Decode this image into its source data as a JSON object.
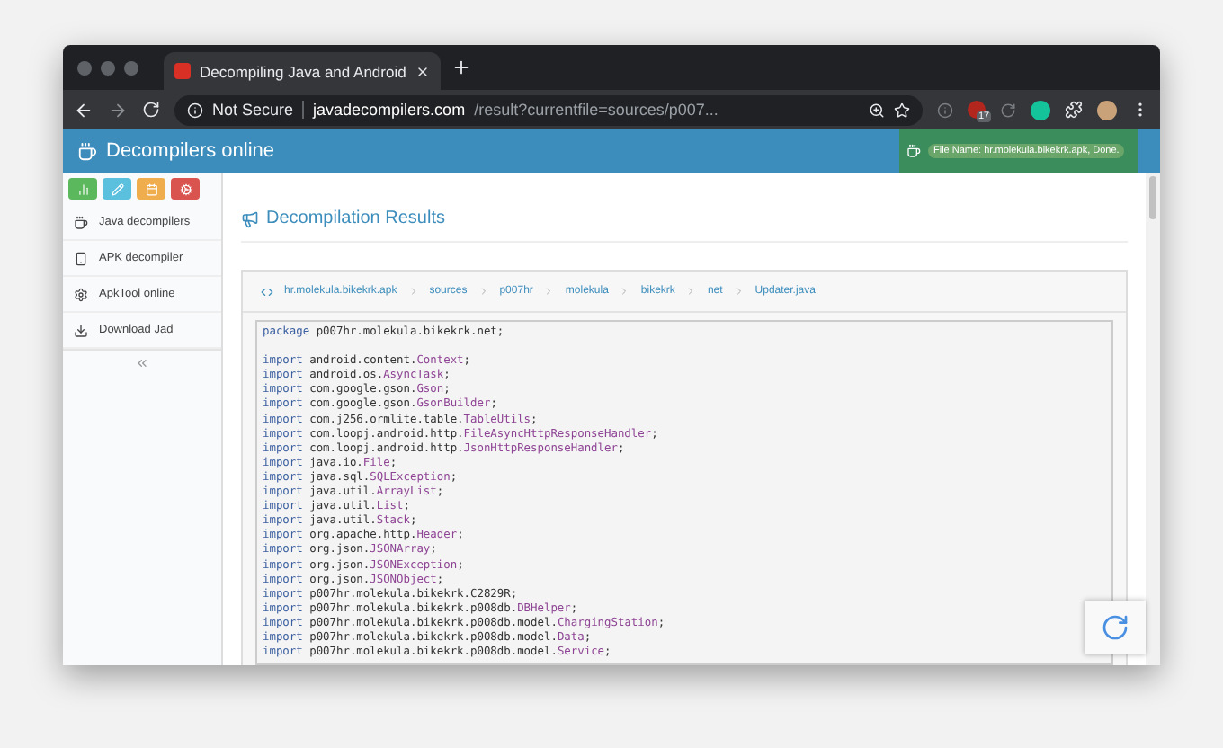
{
  "browser": {
    "tab": {
      "title": "Decompiling Java and Android"
    },
    "address": {
      "security": "Not Secure",
      "domain": "javadecompilers.com",
      "path": "/result?currentfile=sources/p007..."
    },
    "extension_badge": "17"
  },
  "header": {
    "title": "Decompilers online",
    "status": "File Name: hr.molekula.bikekrk.apk, Done."
  },
  "sidebar": {
    "tool_buttons": [
      {
        "kind": "signal",
        "color": "#5cb85c"
      },
      {
        "kind": "pencil",
        "color": "#5bc0de"
      },
      {
        "kind": "calendar",
        "color": "#f0ad4e"
      },
      {
        "kind": "gears",
        "color": "#d9534f"
      }
    ],
    "items": [
      {
        "kind": "cup",
        "label": "Java decompilers"
      },
      {
        "kind": "phone",
        "label": "APK decompiler"
      },
      {
        "kind": "gear",
        "label": "ApkTool online"
      },
      {
        "kind": "download",
        "label": "Download Jad"
      }
    ]
  },
  "heading": "Decompilation Results",
  "breadcrumb": [
    "hr.molekula.bikekrk.apk",
    "sources",
    "p007hr",
    "molekula",
    "bikekrk",
    "net",
    "Updater.java"
  ],
  "code_blocks": [
    [
      {
        "kw": "package",
        "path": "p007hr.molekula.bikekrk.net;"
      }
    ],
    [
      {
        "kw": "import",
        "path": "android.content.",
        "cls": "Context",
        "end": ";"
      },
      {
        "kw": "import",
        "path": "android.os.",
        "cls": "AsyncTask",
        "end": ";"
      },
      {
        "kw": "import",
        "path": "com.google.gson.",
        "cls": "Gson",
        "end": ";"
      },
      {
        "kw": "import",
        "path": "com.google.gson.",
        "cls": "GsonBuilder",
        "end": ";"
      },
      {
        "kw": "import",
        "path": "com.j256.ormlite.table.",
        "cls": "TableUtils",
        "end": ";"
      },
      {
        "kw": "import",
        "path": "com.loopj.android.http.",
        "cls": "FileAsyncHttpResponseHandler",
        "end": ";"
      },
      {
        "kw": "import",
        "path": "com.loopj.android.http.",
        "cls": "JsonHttpResponseHandler",
        "end": ";"
      },
      {
        "kw": "import",
        "path": "java.io.",
        "cls": "File",
        "end": ";"
      },
      {
        "kw": "import",
        "path": "java.sql.",
        "cls": "SQLException",
        "end": ";"
      },
      {
        "kw": "import",
        "path": "java.util.",
        "cls": "ArrayList",
        "end": ";"
      },
      {
        "kw": "import",
        "path": "java.util.",
        "cls": "List",
        "end": ";"
      },
      {
        "kw": "import",
        "path": "java.util.",
        "cls": "Stack",
        "end": ";"
      },
      {
        "kw": "import",
        "path": "org.apache.http.",
        "cls": "Header",
        "end": ";"
      },
      {
        "kw": "import",
        "path": "org.json.",
        "cls": "JSONArray",
        "end": ";"
      },
      {
        "kw": "import",
        "path": "org.json.",
        "cls": "JSONException",
        "end": ";"
      },
      {
        "kw": "import",
        "path": "org.json.",
        "cls": "JSONObject",
        "end": ";"
      },
      {
        "kw": "import",
        "path": "p007hr.molekula.bikekrk.C2829R;"
      },
      {
        "kw": "import",
        "path": "p007hr.molekula.bikekrk.p008db.",
        "cls": "DBHelper",
        "end": ";"
      },
      {
        "kw": "import",
        "path": "p007hr.molekula.bikekrk.p008db.model.",
        "cls": "ChargingStation",
        "end": ";"
      },
      {
        "kw": "import",
        "path": "p007hr.molekula.bikekrk.p008db.model.",
        "cls": "Data",
        "end": ";"
      },
      {
        "kw": "import",
        "path": "p007hr.molekula.bikekrk.p008db.model.",
        "cls": "Service",
        "end": ";"
      }
    ]
  ]
}
